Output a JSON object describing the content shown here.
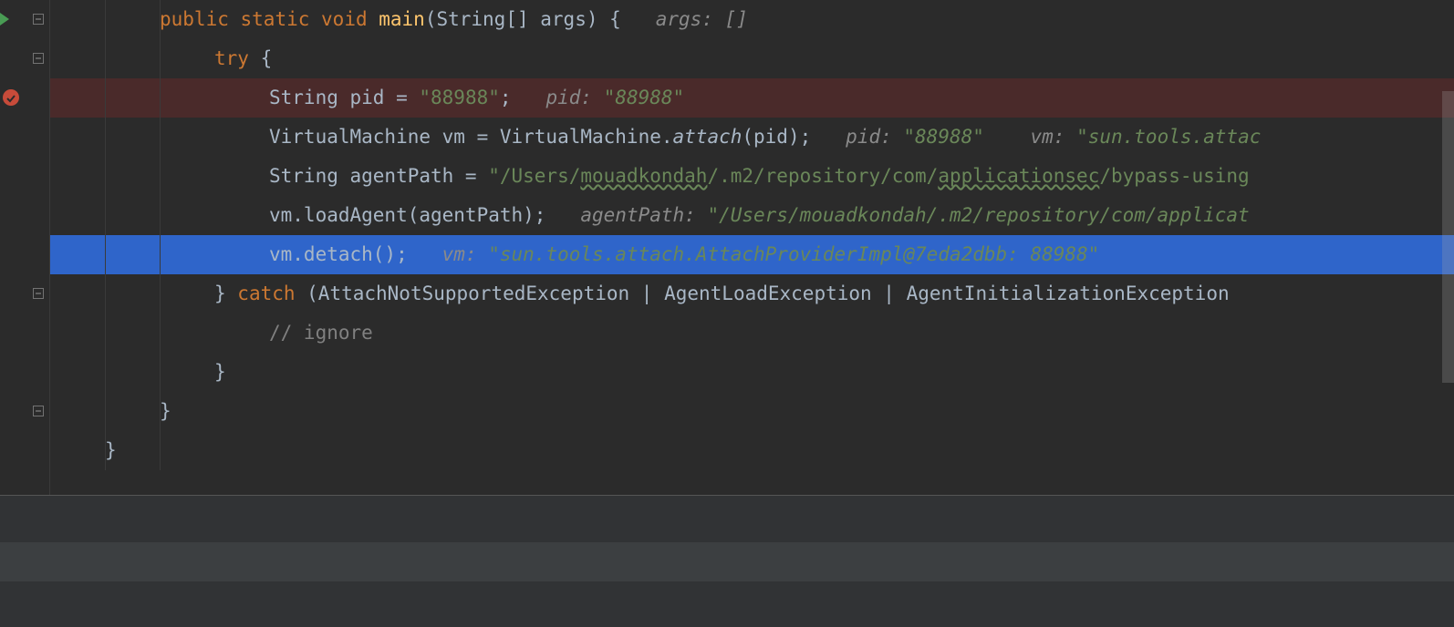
{
  "code": {
    "lines": [
      {
        "indent": 1,
        "segments": [
          {
            "text": "public ",
            "cls": "kw"
          },
          {
            "text": "static ",
            "cls": "kw"
          },
          {
            "text": "void ",
            "cls": "kw"
          },
          {
            "text": "main",
            "cls": "method"
          },
          {
            "text": "(String[] args) {   ",
            "cls": "type"
          },
          {
            "text": "args: []",
            "cls": "hint"
          }
        ],
        "fold": "minus",
        "runArrow": true
      },
      {
        "indent": 2,
        "segments": [
          {
            "text": "try ",
            "cls": "kw"
          },
          {
            "text": "{",
            "cls": "brace"
          }
        ],
        "fold": "minus"
      },
      {
        "indent": 3,
        "highlight": "red",
        "breakpoint": true,
        "segments": [
          {
            "text": "String pid = ",
            "cls": "type"
          },
          {
            "text": "\"88988\"",
            "cls": "str"
          },
          {
            "text": ";   ",
            "cls": "type"
          },
          {
            "text": "pid: ",
            "cls": "hint"
          },
          {
            "text": "\"88988\"",
            "cls": "hint-green"
          }
        ]
      },
      {
        "indent": 3,
        "segments": [
          {
            "text": "VirtualMachine vm = VirtualMachine.",
            "cls": "type"
          },
          {
            "text": "attach",
            "cls": "type italic"
          },
          {
            "text": "(pid);   ",
            "cls": "type"
          },
          {
            "text": "pid: ",
            "cls": "hint"
          },
          {
            "text": "\"88988\"",
            "cls": "hint-green"
          },
          {
            "text": "    vm: ",
            "cls": "hint"
          },
          {
            "text": "\"sun.tools.attac",
            "cls": "hint-green"
          }
        ]
      },
      {
        "indent": 3,
        "segments": [
          {
            "text": "String agentPath = ",
            "cls": "type"
          },
          {
            "text": "\"/Users/",
            "cls": "str"
          },
          {
            "text": "mouadkondah",
            "cls": "str squiggly"
          },
          {
            "text": "/.m2/repository/com/",
            "cls": "str"
          },
          {
            "text": "applicationsec",
            "cls": "str squiggly"
          },
          {
            "text": "/bypass-using",
            "cls": "str"
          }
        ]
      },
      {
        "indent": 3,
        "segments": [
          {
            "text": "vm.loadAgent(agentPath);   ",
            "cls": "type"
          },
          {
            "text": "agentPath: ",
            "cls": "hint"
          },
          {
            "text": "\"/Users/mouadkondah/.m2/repository/com/applicat",
            "cls": "hint-green"
          }
        ]
      },
      {
        "indent": 3,
        "highlight": "blue",
        "segments": [
          {
            "text": "vm.detach();   ",
            "cls": "type"
          },
          {
            "text": "vm: ",
            "cls": "hint"
          },
          {
            "text": "\"sun.tools.attach.AttachProviderImpl@7eda2dbb: 88988\"",
            "cls": "hint-green"
          }
        ]
      },
      {
        "indent": 2,
        "segments": [
          {
            "text": "} ",
            "cls": "brace"
          },
          {
            "text": "catch ",
            "cls": "kw"
          },
          {
            "text": "(AttachNotSupportedException | AgentLoadException | AgentInitializationException ",
            "cls": "type"
          }
        ],
        "fold": "minus"
      },
      {
        "indent": 3,
        "segments": [
          {
            "text": "// ignore",
            "cls": "comment"
          }
        ]
      },
      {
        "indent": 2,
        "segments": [
          {
            "text": "}",
            "cls": "brace"
          }
        ]
      },
      {
        "indent": 1,
        "segments": [
          {
            "text": "}",
            "cls": "brace"
          }
        ],
        "fold": "minus"
      },
      {
        "indent": 0,
        "segments": [
          {
            "text": "}",
            "cls": "brace"
          }
        ]
      }
    ]
  },
  "indentWidth": 60
}
